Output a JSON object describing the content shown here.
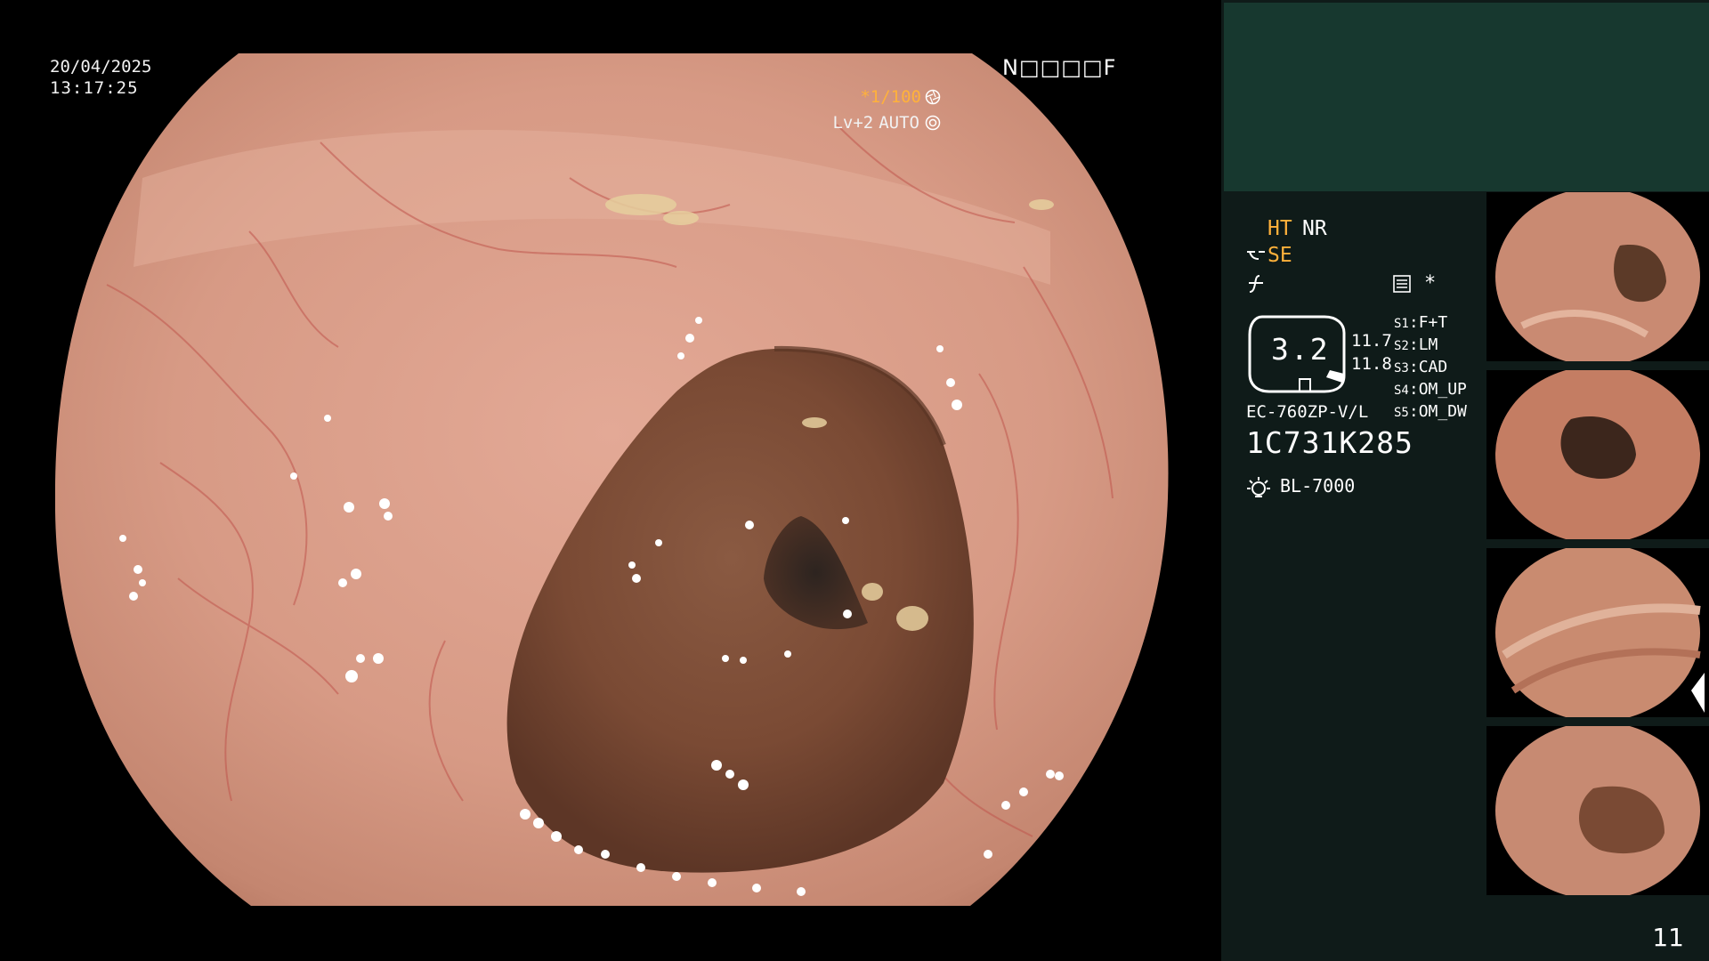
{
  "overlay": {
    "date": "20/04/2025",
    "time": "13:17:25",
    "patient_code": "N□□□□F",
    "shutter": "*1/100",
    "shutter_icon": "aperture-icon",
    "level": "Lv+2",
    "auto": "AUTO",
    "auto_icon": "iris-icon"
  },
  "panel": {
    "modes": {
      "ht": "HT",
      "nr": "NR",
      "se": "SE"
    },
    "asterisk": "*",
    "gauge": {
      "value": "3.2",
      "r1": "11.7",
      "r2": "11.8"
    },
    "switches": [
      {
        "key": "S1",
        "value": "F+T"
      },
      {
        "key": "S2",
        "value": "LM"
      },
      {
        "key": "S3",
        "value": "CAD"
      },
      {
        "key": "S4",
        "value": "OM_UP"
      },
      {
        "key": "S5",
        "value": "OM_DW"
      }
    ],
    "scope_model": "EC-760ZP-V/L",
    "scope_serial": "1C731K285",
    "light_source": "BL-7000",
    "page_number": "11"
  },
  "colors": {
    "accent_orange": "#ffb13b",
    "panel_bg": "#0f1b19",
    "panel_header": "#17382f",
    "mucosa": "#d69a86",
    "lumen": "#7a4a34"
  }
}
